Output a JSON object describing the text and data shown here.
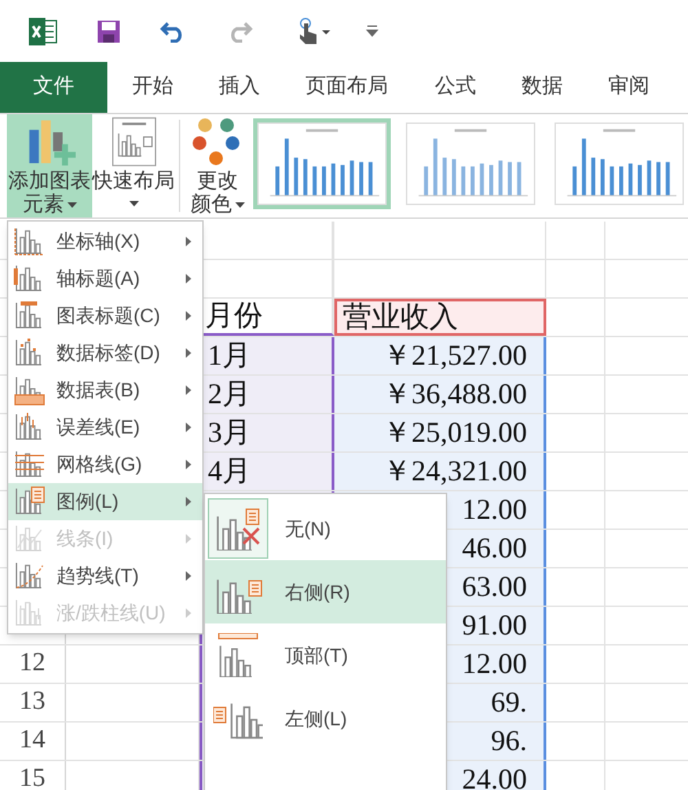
{
  "quick_access": {
    "redo_disabled": true
  },
  "tabs": [
    {
      "label": "文件",
      "kind": "file",
      "selected": false
    },
    {
      "label": "开始",
      "kind": "tab",
      "selected": false
    },
    {
      "label": "插入",
      "kind": "tab",
      "selected": false
    },
    {
      "label": "页面布局",
      "kind": "tab",
      "selected": false
    },
    {
      "label": "公式",
      "kind": "tab",
      "selected": false
    },
    {
      "label": "数据",
      "kind": "tab",
      "selected": false
    },
    {
      "label": "审阅",
      "kind": "tab",
      "selected": false
    }
  ],
  "ribbon": {
    "buttons": [
      {
        "kind": "add-element",
        "lines": [
          "添加图表",
          "元素"
        ],
        "pressed": true
      },
      {
        "kind": "quick-layout",
        "lines": [
          "快速布局"
        ],
        "pressed": false
      },
      {
        "kind": "change-colors",
        "lines": [
          "更改",
          "颜色"
        ],
        "pressed": false
      }
    ],
    "chart_styles": [
      {
        "selected": true
      },
      {
        "selected": false
      },
      {
        "selected": false
      }
    ]
  },
  "sheet": {
    "rows": [
      {},
      {},
      {
        "month": "月份",
        "revenue": "营业收入",
        "kind": "header"
      },
      {
        "month": "1月",
        "revenue": "￥21,527.00"
      },
      {
        "month": "2月",
        "revenue": "￥36,488.00"
      },
      {
        "month": "3月",
        "revenue": "￥25,019.00"
      },
      {
        "month": "4月",
        "revenue": "￥24,321.00"
      },
      {
        "revenue": "12.00"
      },
      {
        "revenue": "46.00"
      },
      {
        "revenue": "63.00"
      },
      {
        "revenue": "91.00"
      },
      {
        "number": "12",
        "revenue": "12.00"
      },
      {
        "number": "13",
        "revenue": "69."
      },
      {
        "number": "14",
        "revenue": "96."
      },
      {
        "number": "15",
        "revenue": "24.00"
      }
    ]
  },
  "menu": {
    "items": [
      {
        "label": "坐标轴(X)",
        "disabled": false,
        "selected": false
      },
      {
        "label": "轴标题(A)",
        "disabled": false,
        "selected": false
      },
      {
        "label": "图表标题(C)",
        "disabled": false,
        "selected": false
      },
      {
        "label": "数据标签(D)",
        "disabled": false,
        "selected": false
      },
      {
        "label": "数据表(B)",
        "disabled": false,
        "selected": false
      },
      {
        "label": "误差线(E)",
        "disabled": false,
        "selected": false
      },
      {
        "label": "网格线(G)",
        "disabled": false,
        "selected": false
      },
      {
        "label": "图例(L)",
        "disabled": false,
        "selected": true
      },
      {
        "label": "线条(I)",
        "disabled": true,
        "selected": false
      },
      {
        "label": "趋势线(T)",
        "disabled": false,
        "selected": false
      },
      {
        "label": "涨/跌柱线(U)",
        "disabled": true,
        "selected": false
      }
    ]
  },
  "submenu": {
    "items": [
      {
        "label": "无(N)",
        "kind": "none",
        "checked": true,
        "selected": false
      },
      {
        "label": "右侧(R)",
        "kind": "right",
        "checked": false,
        "selected": true
      },
      {
        "label": "顶部(T)",
        "kind": "top",
        "checked": false,
        "selected": false
      },
      {
        "label": "左侧(L)",
        "kind": "left",
        "checked": false,
        "selected": false
      }
    ]
  }
}
